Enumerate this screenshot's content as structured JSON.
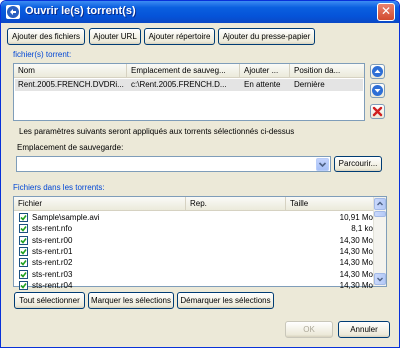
{
  "window": {
    "title": "Ouvrir le(s) torrent(s)",
    "icon": "bittorrent-logo-icon",
    "close_label": "✕"
  },
  "toolbar": {
    "add_files": "Ajouter des fichiers",
    "add_url": "Ajouter URL",
    "add_dir": "Ajouter répertoire",
    "add_clipboard": "Ajouter du presse-papier"
  },
  "torrents_group": {
    "label": "fichier(s) torrent:",
    "columns": [
      "Nom",
      "Emplacement de sauveg...",
      "Ajouter ...",
      "Position da..."
    ],
    "rows": [
      [
        "Rent.2005.FRENCH.DVDRi...",
        "c:\\Rent.2005.FRENCH.D...",
        "En attente",
        "Dernière"
      ]
    ],
    "side_buttons": [
      "arrow-up-icon",
      "arrow-down-icon",
      "remove-icon"
    ]
  },
  "settings": {
    "info_text": "Les paramètres suivants seront appliqués aux torrents sélectionnés ci-dessus",
    "save_location_label": "Emplacement de sauvegarde:",
    "save_location_value": "",
    "browse_label": "Parcourir..."
  },
  "files_group": {
    "label": "Fichiers dans les torrents:",
    "columns": [
      "Fichier",
      "Rep.",
      "Taille"
    ],
    "rows": [
      {
        "name": "Sample\\sample.avi",
        "rep": "",
        "size": "10,91 Mo",
        "checked": true
      },
      {
        "name": "sts-rent.nfo",
        "rep": "",
        "size": "8,1 ko",
        "checked": true
      },
      {
        "name": "sts-rent.r00",
        "rep": "",
        "size": "14,30 Mo",
        "checked": true
      },
      {
        "name": "sts-rent.r01",
        "rep": "",
        "size": "14,30 Mo",
        "checked": true
      },
      {
        "name": "sts-rent.r02",
        "rep": "",
        "size": "14,30 Mo",
        "checked": true
      },
      {
        "name": "sts-rent.r03",
        "rep": "",
        "size": "14,30 Mo",
        "checked": true
      },
      {
        "name": "sts-rent.r04",
        "rep": "",
        "size": "14,30 Mo",
        "checked": true
      }
    ],
    "select_all": "Tout sélectionner",
    "mark": "Marquer les sélections",
    "unmark": "Démarquer les sélections"
  },
  "footer": {
    "ok": "OK",
    "cancel": "Annuler"
  },
  "colors": {
    "titlebar": "#0553d8",
    "group_label": "#0046d5",
    "selected_row": "#e4e4e4",
    "remove_red": "#d02020",
    "arrow_blue": "#2e6fd6",
    "check_green": "#21a121"
  }
}
